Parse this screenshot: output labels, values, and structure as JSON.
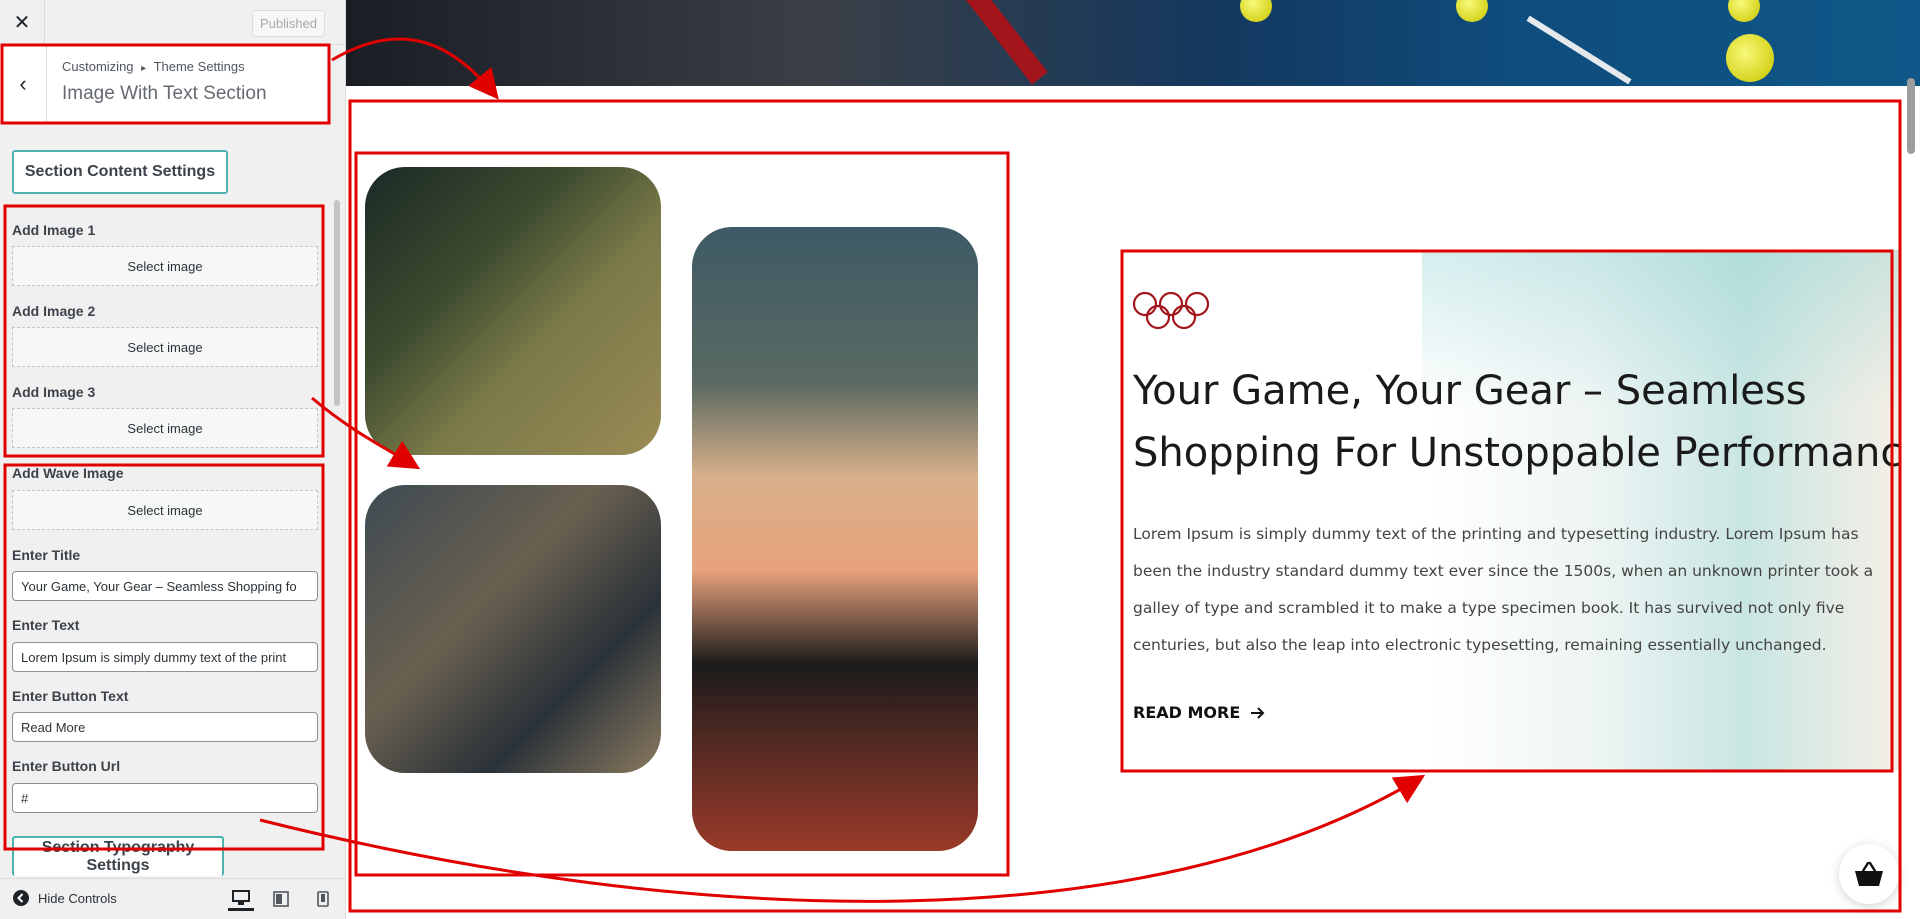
{
  "topbar": {
    "close_icon": "close-icon",
    "published_label": "Published"
  },
  "section_header": {
    "breadcrumb_root": "Customizing",
    "breadcrumb_sep": "▸",
    "breadcrumb_parent": "Theme Settings",
    "title": "Image With Text Section"
  },
  "groups": {
    "content_settings": "Section Content Settings",
    "typography_settings": "Section Typography Settings"
  },
  "controls": {
    "image1_label": "Add Image 1",
    "image2_label": "Add Image 2",
    "image3_label": "Add Image 3",
    "wave_label": "Add Wave Image",
    "select_image": "Select image",
    "title_label": "Enter Title",
    "title_value": "Your Game, Your Gear – Seamless Shopping fo",
    "text_label": "Enter Text",
    "text_value": "Lorem Ipsum is simply dummy text of the print",
    "button_text_label": "Enter Button Text",
    "button_text_value": "Read More",
    "button_url_label": "Enter Button Url",
    "button_url_value": "#"
  },
  "footer": {
    "hide_controls": "Hide Controls"
  },
  "preview": {
    "title_line1": "Your Game, Your Gear – Seamless",
    "title_line2": "Shopping For Unstoppable Performance.",
    "body_text": "Lorem Ipsum is simply dummy text of the printing and typesetting industry. Lorem Ipsum has been the industry standard dummy text ever since the 1500s, when an unknown printer took a galley of type and scrambled it to make a type specimen book. It has survived not only five centuries, but also the leap into electronic typesetting, remaining essentially unchanged.",
    "read_more": "READ MORE"
  },
  "colors": {
    "accent_teal": "#4ab4ad",
    "annotation_red": "#e00000",
    "olympic_red": "#a3151b"
  }
}
